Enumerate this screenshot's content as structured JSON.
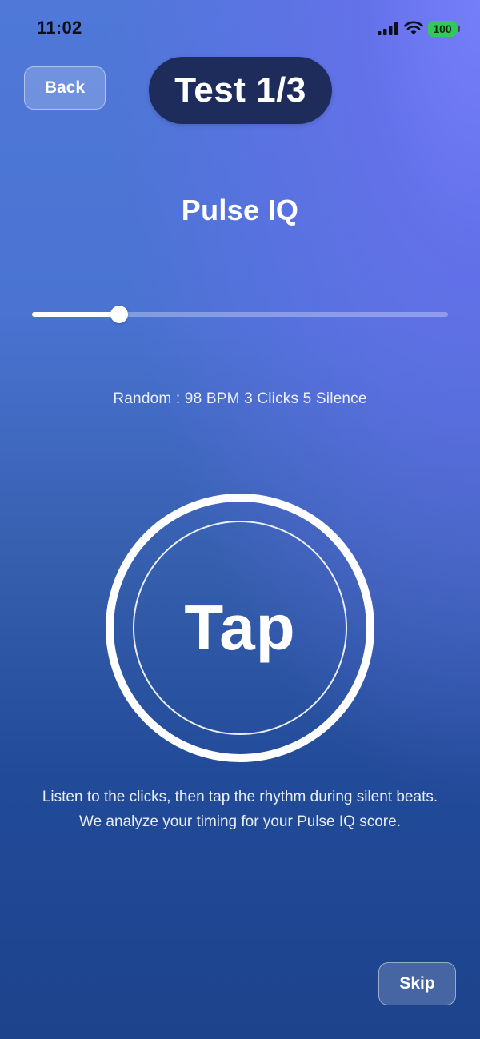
{
  "status_bar": {
    "time": "11:02",
    "battery": "100",
    "battery_color": "#34c759",
    "icons": [
      "cellular-signal-icon",
      "wifi-icon",
      "battery-icon"
    ]
  },
  "header": {
    "back_label": "Back",
    "test_label": "Test 1/3"
  },
  "title": "Pulse IQ",
  "progress": {
    "value_fraction": 0.21
  },
  "subtitle": "Random : 98 BPM 3 Clicks 5 Silence",
  "tap_button": {
    "label": "Tap"
  },
  "instructions": "Listen to the clicks, then tap the rhythm during silent beats. We analyze your timing for your Pulse IQ score.",
  "skip_label": "Skip",
  "colors": {
    "background_top": "#4f78d8",
    "background_bottom": "#1d438c",
    "pill": "#1e2c5c"
  }
}
